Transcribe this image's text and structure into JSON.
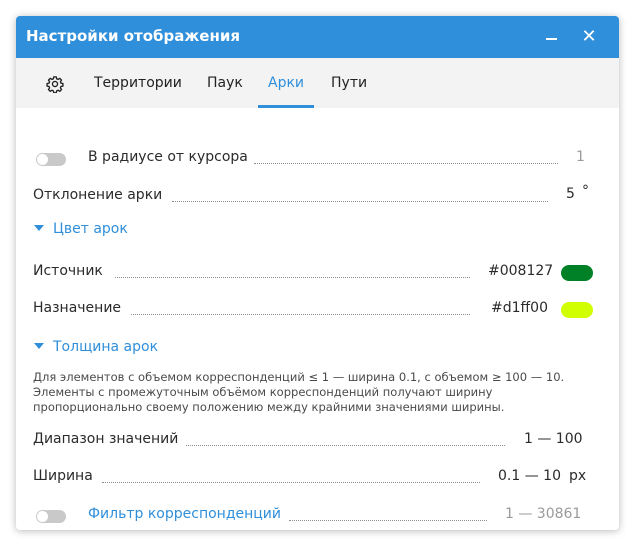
{
  "window": {
    "title": "Настройки отображения",
    "minimize_glyph": "—",
    "close_glyph": "✕"
  },
  "tabs": [
    {
      "label": "Территории"
    },
    {
      "label": "Паук"
    },
    {
      "label": "Арки",
      "active": true
    },
    {
      "label": "Пути"
    }
  ],
  "settings": {
    "cursor_radius": {
      "label": "В радиусе от курсора",
      "value": "1",
      "enabled": false
    },
    "arc_deviation": {
      "label": "Отклонение арки",
      "value": "5",
      "unit": "°"
    },
    "arc_color": {
      "heading": "Цвет арок",
      "source": {
        "label": "Источник",
        "hex": "#008127"
      },
      "target": {
        "label": "Назначение",
        "hex": "#d1ff00"
      }
    },
    "arc_width": {
      "heading": "Толщина арок",
      "description_line1": "Для элементов с объемом корреспонденций ≤ 1 — ширина 0.1, с объемом ≥ 100 — 10.",
      "description_line2": "Элементы с промежуточным объёмом корреспонденций получают ширину",
      "description_line3": "пропорционально своему положению между крайними значениями ширины.",
      "range": {
        "label": "Диапазон значений",
        "value": "1 — 100"
      },
      "width": {
        "label": "Ширина",
        "value": "0.1 — 10",
        "unit": "px"
      }
    },
    "correspondence_filter": {
      "label": "Фильтр корреспонденций",
      "value": "1 — 30861",
      "enabled": false
    }
  },
  "colors": {
    "accent": "#2f8fdb",
    "source_swatch": "#008127",
    "target_swatch": "#d1ff00",
    "toggle_off": "#c9c9c9"
  },
  "icons": {
    "settings_tab": "gear-icon",
    "minimize": "minimize-icon",
    "close": "close-icon",
    "section_caret": "caret-down-icon"
  }
}
